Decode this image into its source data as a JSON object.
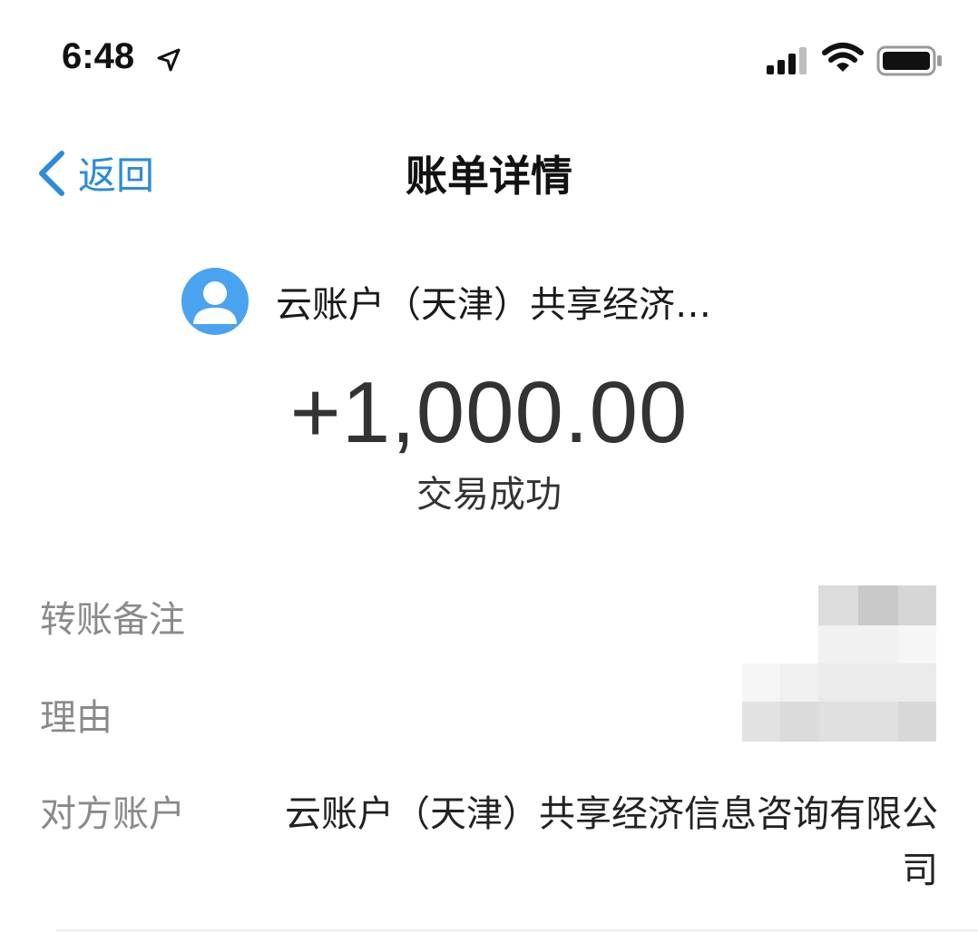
{
  "status_bar": {
    "time": "6:48",
    "icons": [
      "location-arrow-icon",
      "cellular-signal-icon",
      "wifi-icon",
      "battery-icon"
    ]
  },
  "nav": {
    "back_label": "返回",
    "title": "账单详情"
  },
  "header": {
    "payee_name": "云账户（天津）共享经济…",
    "amount": "+1,000.00",
    "status": "交易成功"
  },
  "details": {
    "remark_label": "转账备注",
    "reason_label": "理由",
    "counterparty_label": "对方账户",
    "counterparty_value_line1": "云账户（天津）共享经济信息咨询有限公",
    "counterparty_value_line2": "司"
  },
  "colors": {
    "accent": "#2d8bd8",
    "avatar": "#4aa3ee",
    "label_gray": "#8a8a8a"
  }
}
